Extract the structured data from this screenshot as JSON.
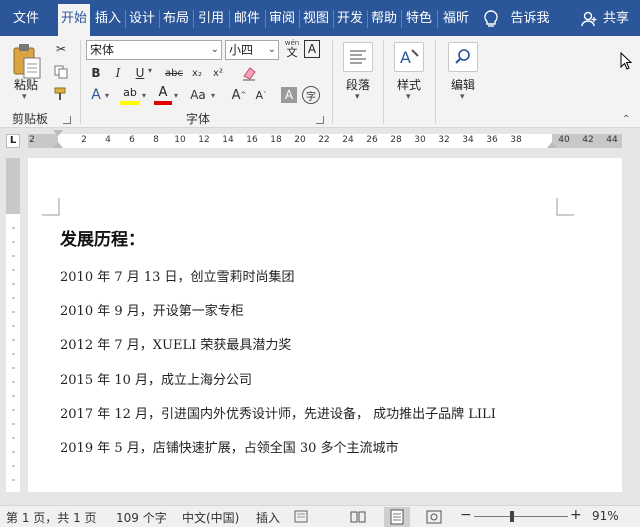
{
  "tabs": [
    {
      "label": "文件",
      "active": false
    },
    {
      "label": "开始",
      "active": true
    },
    {
      "label": "插入",
      "active": false
    },
    {
      "label": "设计",
      "active": false
    },
    {
      "label": "布局",
      "active": false
    },
    {
      "label": "引用",
      "active": false
    },
    {
      "label": "邮件",
      "active": false
    },
    {
      "label": "审阅",
      "active": false
    },
    {
      "label": "视图",
      "active": false
    },
    {
      "label": "开发",
      "active": false
    },
    {
      "label": "帮助",
      "active": false
    },
    {
      "label": "特色",
      "active": false
    },
    {
      "label": "福昕",
      "active": false
    }
  ],
  "tell_me": "告诉我",
  "share": "共享",
  "ribbon": {
    "clipboard": {
      "paste": "粘贴",
      "group": "剪贴板"
    },
    "font": {
      "name": "宋体",
      "size": "小四",
      "wen_glyph": "wén",
      "wen_char": "文",
      "a_box": "A",
      "bold": "B",
      "italic": "I",
      "underline": "U",
      "strike": "abc",
      "sub": "x₂",
      "sup": "x²",
      "effects": "A",
      "highlight": "ab",
      "fontcolor": "A",
      "case": "Aa",
      "grow": "A",
      "shrink": "A",
      "shade": "A",
      "circle": "字",
      "group": "字体"
    },
    "paragraph": {
      "label": "段落"
    },
    "styles": {
      "label": "样式"
    },
    "editing": {
      "label": "编辑"
    }
  },
  "ruler": {
    "tab_marker": "L",
    "ticks": [
      "2",
      "2",
      "4",
      "6",
      "8",
      "10",
      "12",
      "14",
      "16",
      "18",
      "20",
      "22",
      "24",
      "26",
      "28",
      "30",
      "32",
      "34",
      "36",
      "38",
      "40",
      "42",
      "44"
    ]
  },
  "document": {
    "title": "发展历程：",
    "lines": [
      "2010 年 7 月 13 日，创立雪莉时尚集团",
      "2010 年 9 月，开设第一家专柜",
      "2012 年 7 月，XUELI 荣获最具潜力奖",
      "2015 年 10 月，成立上海分公司",
      "2017 年 12 月，引进国内外优秀设计师，先进设备，  成功推出子品牌 LILI",
      "2019 年 5 月，店铺快速扩展，占领全国 30 多个主流城市"
    ]
  },
  "status": {
    "pages": "第 1 页，共 1 页",
    "words": "109 个字",
    "language": "中文(中国)",
    "mode": "插入",
    "minus": "−",
    "plus": "+",
    "zoom": "91%"
  },
  "colors": {
    "accent": "#2b579a",
    "highlight": "#ffff00",
    "fontcolor": "#e00000"
  }
}
